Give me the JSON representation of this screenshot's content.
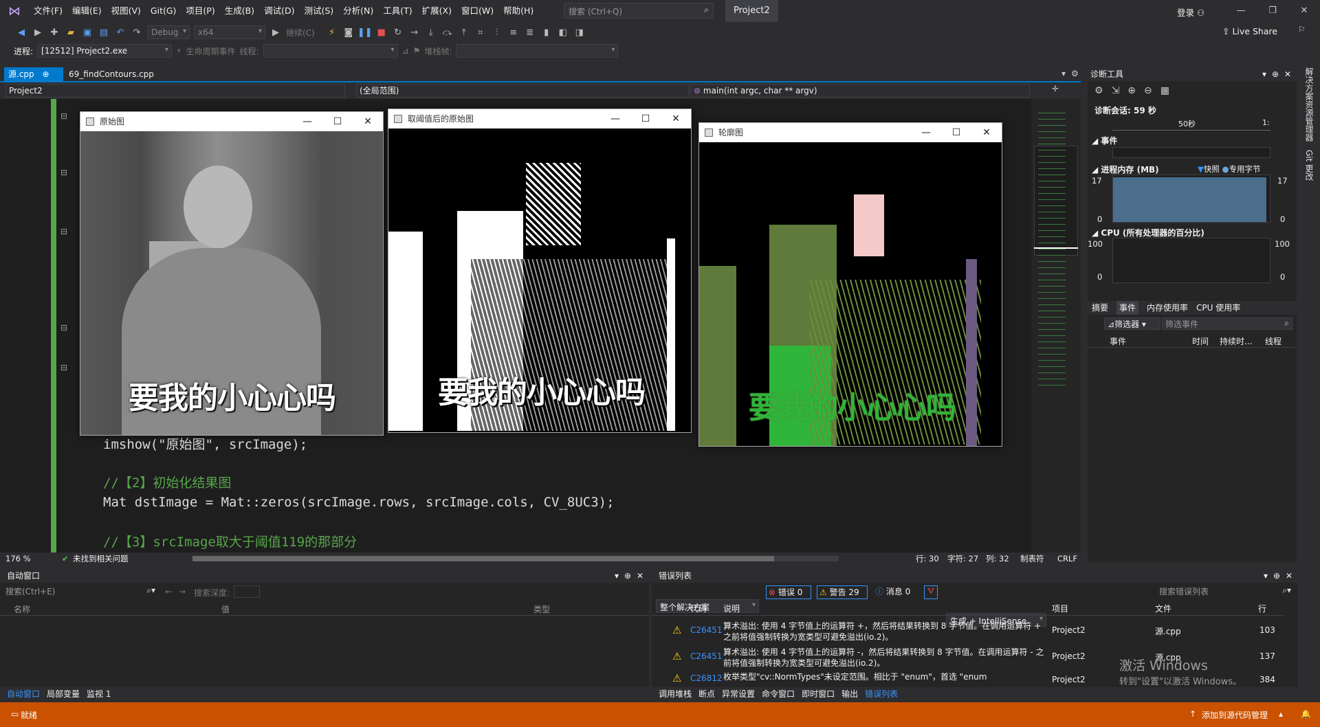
{
  "menubar": {
    "items": [
      "文件(F)",
      "编辑(E)",
      "视图(V)",
      "Git(G)",
      "项目(P)",
      "生成(B)",
      "调试(D)",
      "测试(S)",
      "分析(N)",
      "工具(T)",
      "扩展(X)",
      "窗口(W)",
      "帮助(H)"
    ],
    "search_placeholder": "搜索 (Ctrl+Q)",
    "project_name": "Project2",
    "signin": "登录",
    "live_share": "Live Share"
  },
  "toolbar": {
    "config": "Debug",
    "platform": "x64",
    "continue": "继续(C)"
  },
  "toolbar2": {
    "process_label": "进程:",
    "process_value": "[12512] Project2.exe",
    "lifecycle": "生命周期事件",
    "thread_label": "线程:",
    "stackframe_label": "堆栈帧:"
  },
  "tabs": [
    {
      "label": "源.cpp",
      "pin": "⊕",
      "close": "✕"
    },
    {
      "label": "69_findContours.cpp"
    }
  ],
  "nav": {
    "project": "Project2",
    "scope": "(全局范围)",
    "function": "main(int argc, char ** argv)"
  },
  "code_lines": [
    {
      "text": "imshow(\"原始图\", srcImage);",
      "kind": "code"
    },
    {
      "text": "//【2】初始化结果图",
      "kind": "comment"
    },
    {
      "text": "Mat dstImage = Mat::zeros(srcImage.rows, srcImage.cols, CV_8UC3);",
      "kind": "code"
    },
    {
      "text": "//【3】srcImage取大于阈值119的那部分",
      "kind": "comment"
    }
  ],
  "editor_status": {
    "zoom": "176 %",
    "issues": "未找到相关问题",
    "line": "行: 30",
    "char": "字符: 27",
    "col": "列: 32",
    "tabs": "制表符",
    "eol": "CRLF"
  },
  "windows": [
    {
      "title": "原始图",
      "caption": "要我的小心心吗"
    },
    {
      "title": "取阈值后的原始图",
      "caption": "要我的小心心吗"
    },
    {
      "title": "轮廓图",
      "caption": "要我的小心心吗"
    }
  ],
  "diagnostics": {
    "title": "诊断工具",
    "session": "诊断会话: 59 秒",
    "timeline_label_1": "50秒",
    "timeline_label_2": "1:",
    "events_title": "事件",
    "memory_title": "进程内存 (MB)",
    "snapshot": "快照",
    "private_bytes": "专用字节",
    "mem_max": "17",
    "mem_min": "0",
    "cpu_title": "CPU (所有处理器的百分比)",
    "cpu_max": "100",
    "cpu_min": "0",
    "tabs": [
      "摘要",
      "事件",
      "内存使用率",
      "CPU 使用率"
    ],
    "filter": "筛选器",
    "filter_placeholder": "筛选事件",
    "cols": [
      "事件",
      "时间",
      "持续时...",
      "线程"
    ],
    "memory_fill": 0.95
  },
  "autos": {
    "title": "自动窗口",
    "search_placeholder": "搜索(Ctrl+E)",
    "depth_label": "搜索深度:",
    "cols": [
      "名称",
      "值",
      "类型"
    ],
    "tabs": [
      "自动窗口",
      "局部变量",
      "监视 1"
    ]
  },
  "errors": {
    "title": "错误列表",
    "scope": "整个解决方案",
    "errors_btn": "错误 0",
    "warnings_btn": "警告 29",
    "messages_btn": "消息 0",
    "build_filter": "生成 + IntelliSense",
    "search_placeholder": "搜索错误列表",
    "cols": [
      "代码",
      "说明",
      "项目",
      "文件",
      "行"
    ],
    "rows": [
      {
        "code": "C26451",
        "desc1": "算术溢出: 使用 4 字节值上的运算符 +，然后将结果转换到 8 字节值。在调用运算符 +",
        "desc2": "之前将值强制转换为宽类型可避免溢出(io.2)。",
        "project": "Project2",
        "file": "源.cpp",
        "line": "103"
      },
      {
        "code": "C26451",
        "desc1": "算术溢出: 使用 4 字节值上的运算符 -，然后将结果转换到 8 字节值。在调用运算符 - 之",
        "desc2": "前将值强制转换为宽类型可避免溢出(io.2)。",
        "project": "Project2",
        "file": "源.cpp",
        "line": "137"
      },
      {
        "code": "C26812",
        "desc1": "枚举类型\"cv::NormTypes\"未设定范围。相比于 \"enum\"，首选 \"enum",
        "desc2": "",
        "project": "Project2",
        "file": "",
        "line": "384"
      }
    ],
    "tabs": [
      "调用堆栈",
      "断点",
      "异常设置",
      "命令窗口",
      "即时窗口",
      "输出",
      "错误列表"
    ]
  },
  "activation": {
    "line1": "激活 Windows",
    "line2": "转到\"设置\"以激活 Windows。"
  },
  "status": {
    "ready": "就绪",
    "source_control": "添加到源代码管理"
  },
  "right_strip": [
    "解决方案资源管理器",
    "Git 更改"
  ]
}
